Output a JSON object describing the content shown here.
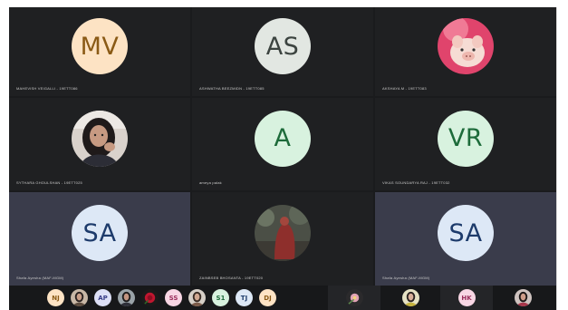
{
  "tiles": [
    {
      "initials": "MV",
      "name": "MAHEVISH VEIGALLI - 19ETT086",
      "bg": "#fde3c4",
      "fg": "#8a5a15"
    },
    {
      "initials": "AS",
      "name": "ASHWATHA BEEZMIDN - 19ETT085",
      "bg": "#e2e7e2",
      "fg": "#3c4440"
    },
    {
      "initials": "",
      "name": "AKSHAYA M - 19ETT083",
      "avatar_icon": "pig-plush-photo"
    },
    {
      "initials": "",
      "name": "SYTHARA GHOULSHAN - 19ETT025",
      "avatar_icon": "woman-portrait-photo"
    },
    {
      "initials": "A",
      "name": "ameya palak",
      "bg": "#d8f2df",
      "fg": "#1d6b3a"
    },
    {
      "initials": "VR",
      "name": "VIKAS SOUNDARYA RAJ - 19ETT032",
      "bg": "#d8f2df",
      "fg": "#1d6b3a"
    },
    {
      "initials": "SA",
      "name": "Shafa Ayesha (MAF-MGM)",
      "bg": "#dde8f6",
      "fg": "#1d3b6b",
      "highlight": true
    },
    {
      "initials": "",
      "name": "ZAINBSEB BHOSANTA - 19ETT020",
      "avatar_icon": "red-figure-photo"
    },
    {
      "initials": "SA",
      "name": "Shafa Ayesha (MAF-MGM)",
      "bg": "#dde8f6",
      "fg": "#1d3b6b",
      "highlight": true
    }
  ],
  "strip": [
    {
      "initials": "NJ",
      "bg": "#fde3c4",
      "fg": "#8a5a15"
    },
    {
      "initials": "",
      "avatar_icon": "portrait-photo-1"
    },
    {
      "initials": "AP",
      "bg": "#dde0f7",
      "fg": "#3a3f8a"
    },
    {
      "initials": "",
      "avatar_icon": "portrait-photo-2"
    },
    {
      "initials": "",
      "avatar_icon": "rose-photo"
    },
    {
      "initials": "SS",
      "bg": "#f8d6e4",
      "fg": "#9a2d5b"
    },
    {
      "initials": "",
      "avatar_icon": "portrait-photo-3"
    },
    {
      "initials": "S1",
      "bg": "#d8f2df",
      "fg": "#1d6b3a"
    },
    {
      "initials": "TJ",
      "bg": "#dde8f6",
      "fg": "#1d3b6b"
    },
    {
      "initials": "DJ",
      "bg": "#fde3c4",
      "fg": "#8a5a15"
    }
  ],
  "strip_tiles": [
    {
      "initials": "",
      "avatar_icon": "flower-photo"
    },
    {
      "initials": "",
      "avatar_icon": "portrait-photo-4"
    },
    {
      "initials": "HK",
      "bg": "#f8d6e4",
      "fg": "#9a2d5b"
    },
    {
      "initials": "",
      "avatar_icon": "portrait-photo-5"
    }
  ]
}
